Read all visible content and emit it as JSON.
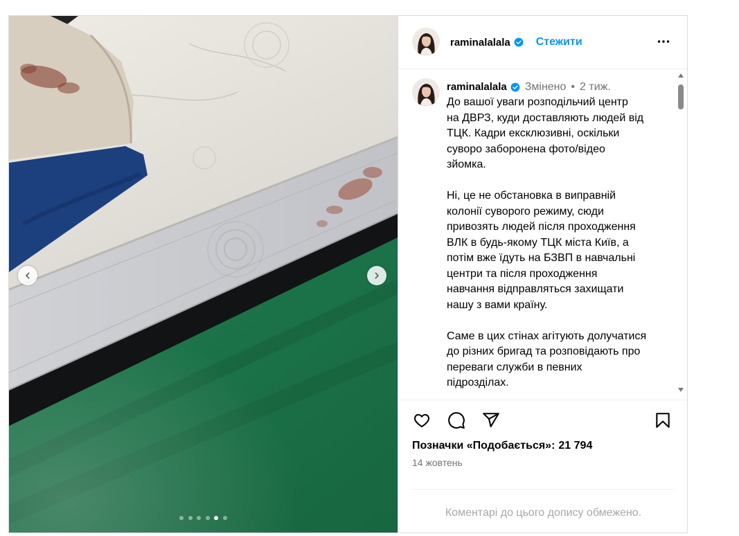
{
  "app": {
    "accent_color": "#0095f6",
    "text_secondary_color": "#737373"
  },
  "account": {
    "username": "raminalalala",
    "verified": true
  },
  "header": {
    "follow_label": "Стежити",
    "avatar_icon": "avatar",
    "verified_icon": "verified-badge-icon",
    "more_icon": "more-options-icon"
  },
  "caption": {
    "edited_label": "Змінено",
    "separator": "•",
    "time": "2 тиж.",
    "paragraphs": [
      "До вашої уваги розподільчий центр\nна ДВРЗ, куди доставляють людей від\nТЦК. Кадри ексклюзивні, оскільки\nсуворо заборонена фото/відео\nзйомка.",
      "Ні, це не обстановка в виправній\nколонії суворого режиму, сюди\nпривозять людей після проходження\nВЛК в будь-якому ТЦК міста Київ, а\nпотім вже їдуть на БЗВП в навчальні\nцентри та після проходження\nнавчання відправляться захищати\nнашу з вами країну.",
      "Саме в цих стінах агітують долучатися\nдо різних бригад та розповідають про\nпереваги служби в певних\nпідрозділах."
    ]
  },
  "actions": {
    "like_icon": "heart-icon",
    "comment_icon": "comment-icon",
    "share_icon": "share-icon",
    "save_icon": "bookmark-icon"
  },
  "likes": {
    "label": "Позначки «Подобається»:",
    "count": "21 794"
  },
  "date": "14 жовтень",
  "comments_notice": "Коментарі до цього допису обмежено.",
  "carousel": {
    "slide_count": 6,
    "active_slide": 5,
    "prev_icon": "chevron-left-icon",
    "next_icon": "chevron-right-icon"
  }
}
